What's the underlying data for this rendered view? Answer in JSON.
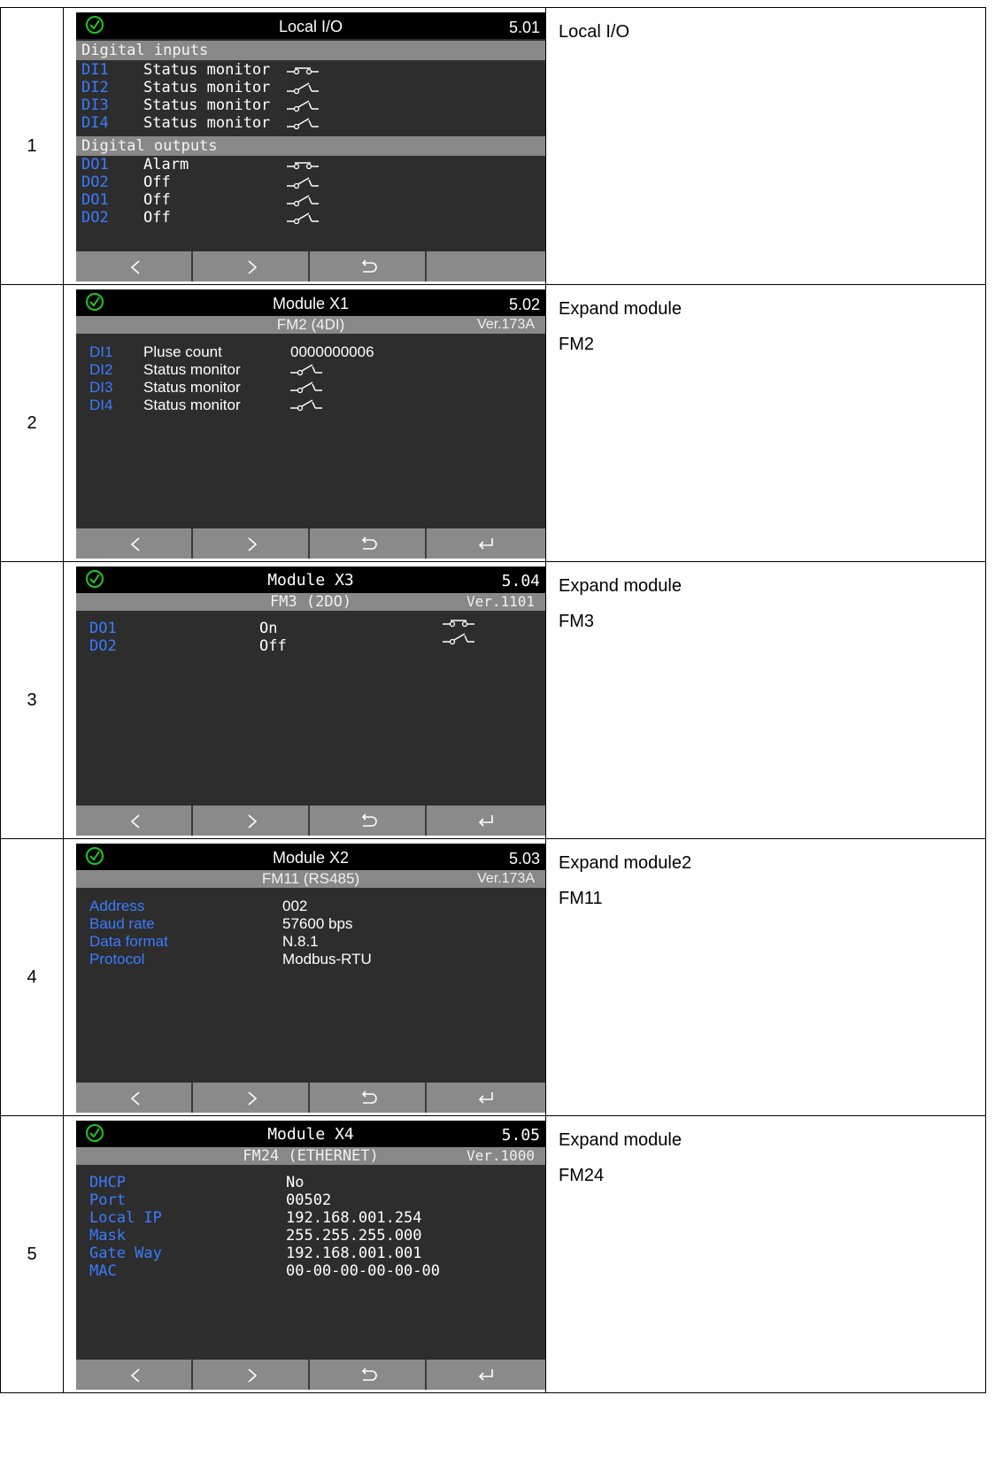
{
  "rows": [
    {
      "index": "1",
      "screen": {
        "title": "Local I/O",
        "page": "5.01",
        "sections": [
          {
            "label": "Digital inputs",
            "items": [
              {
                "id": "DI1",
                "value": "Status monitor",
                "state": "closed"
              },
              {
                "id": "DI2",
                "value": "Status monitor",
                "state": "open"
              },
              {
                "id": "DI3",
                "value": "Status monitor",
                "state": "open"
              },
              {
                "id": "DI4",
                "value": "Status monitor",
                "state": "open"
              }
            ]
          },
          {
            "label": "Digital outputs",
            "items": [
              {
                "id": "DO1",
                "value": "Alarm",
                "state": "closed"
              },
              {
                "id": "DO2",
                "value": "Off",
                "state": "open"
              },
              {
                "id": "DO1",
                "value": "Off",
                "state": "open"
              },
              {
                "id": "DO2",
                "value": "Off",
                "state": "open"
              }
            ]
          }
        ],
        "buttons": [
          "prev",
          "next",
          "back",
          ""
        ]
      },
      "desc": [
        "Local I/O"
      ]
    },
    {
      "index": "2",
      "screen": {
        "title": "Module X1",
        "page": "5.02",
        "subtitle": "FM2 (4DI)",
        "version": "Ver.173A",
        "items": [
          {
            "id": "DI1",
            "value": "Pluse count",
            "extra": "0000000006"
          },
          {
            "id": "DI2",
            "value": "Status monitor",
            "state": "open"
          },
          {
            "id": "DI3",
            "value": "Status monitor",
            "state": "open"
          },
          {
            "id": "DI4",
            "value": "Status monitor",
            "state": "open"
          }
        ],
        "buttons": [
          "prev",
          "next",
          "back",
          "enter"
        ]
      },
      "desc": [
        "Expand module",
        "FM2"
      ]
    },
    {
      "index": "3",
      "screen": {
        "title": "Module X3",
        "page": "5.04",
        "subtitle": "FM3 (2DO)",
        "version": "Ver.1101",
        "items": [
          {
            "id": "DO1",
            "value": "On",
            "state": "closed"
          },
          {
            "id": "DO2",
            "value": "Off",
            "state": "open"
          }
        ],
        "buttons": [
          "prev",
          "next",
          "back",
          "enter"
        ]
      },
      "desc": [
        "Expand module",
        "FM3"
      ]
    },
    {
      "index": "4",
      "screen": {
        "title": "Module X2",
        "page": "5.03",
        "subtitle": "FM11 (RS485)",
        "version": "Ver.173A",
        "items": [
          {
            "id": "Address",
            "value": "002"
          },
          {
            "id": "Baud rate",
            "value": "57600 bps"
          },
          {
            "id": "Data format",
            "value": "N.8.1"
          },
          {
            "id": "Protocol",
            "value": "Modbus-RTU"
          }
        ],
        "buttons": [
          "prev",
          "next",
          "back",
          "enter"
        ]
      },
      "desc": [
        "Expand module2",
        "FM11"
      ]
    },
    {
      "index": "5",
      "screen": {
        "title": "Module X4",
        "page": "5.05",
        "subtitle": "FM24 (ETHERNET)",
        "version": "Ver.1000",
        "items": [
          {
            "id": "DHCP",
            "value": "No"
          },
          {
            "id": "Port",
            "value": "00502"
          },
          {
            "id": "Local IP",
            "value": "192.168.001.254"
          },
          {
            "id": "Mask",
            "value": "255.255.255.000"
          },
          {
            "id": "Gate Way",
            "value": "192.168.001.001"
          },
          {
            "id": "MAC",
            "value": "00-00-00-00-00-00"
          }
        ],
        "buttons": [
          "prev",
          "next",
          "back",
          "enter"
        ]
      },
      "desc": [
        "Expand module",
        "FM24"
      ]
    }
  ],
  "colors": {
    "label_blue": "#3a7cff",
    "status_ok_green": "#22c522",
    "screen_bg": "#2d2d2d",
    "bar_gray": "#888888"
  },
  "icons": {
    "status": "check-circle-icon",
    "prev": "chevron-left-icon",
    "next": "chevron-right-icon",
    "back": "return-arrow-icon",
    "enter": "enter-key-icon",
    "switch": "switch-contact-icon"
  }
}
